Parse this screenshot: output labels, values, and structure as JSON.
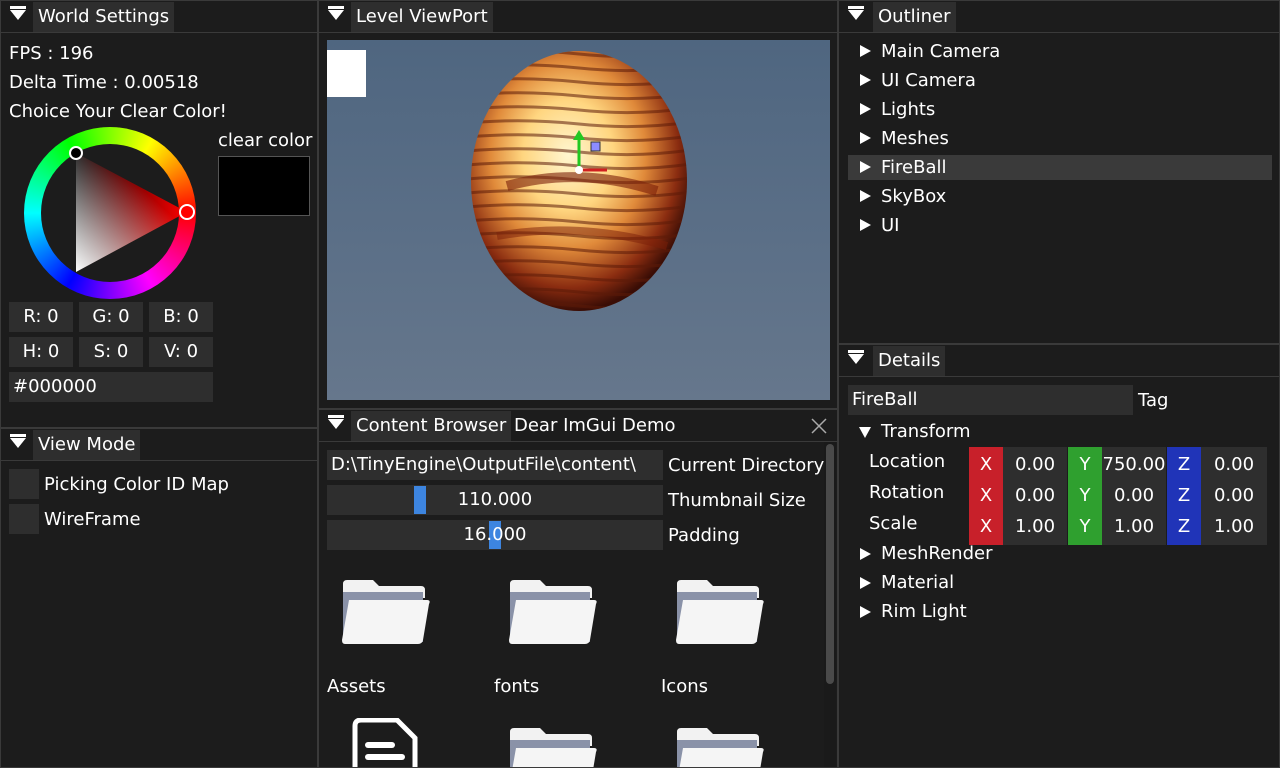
{
  "world_settings": {
    "tab": "World Settings",
    "fps": "FPS : 196",
    "delta": "Delta Time : 0.00518",
    "choice": "Choice Your Clear Color!",
    "clear_color_label": "clear color",
    "clear_color_value": "#000000",
    "r": "R:  0",
    "g": "G:  0",
    "b": "B:  0",
    "h": "H:  0",
    "s": "S:  0",
    "v": "V:  0",
    "hex": "#000000"
  },
  "view_mode": {
    "tab": "View Mode",
    "picking": "Picking Color ID Map",
    "wireframe": "WireFrame"
  },
  "viewport": {
    "tab": "Level ViewPort"
  },
  "content_browser": {
    "tab_active": "Content Browser",
    "tab_other": "Dear ImGui Demo",
    "directory_value": "D:\\TinyEngine\\OutputFile\\content\\",
    "directory_label": "Current Directory",
    "thumbnail_value": "110.000",
    "thumbnail_label": "Thumbnail Size",
    "thumbnail_fraction": 0.27,
    "padding_value": "16.000",
    "padding_label": "Padding",
    "padding_fraction": 0.5,
    "items": [
      "Assets",
      "fonts",
      "Icons"
    ]
  },
  "outliner": {
    "tab": "Outliner",
    "items": [
      "Main Camera",
      "UI Camera",
      "Lights",
      "Meshes",
      "FireBall",
      "SkyBox",
      "UI"
    ],
    "selected": "FireBall"
  },
  "details": {
    "tab": "Details",
    "name": "FireBall",
    "tag_label": "Tag",
    "transform_label": "Transform",
    "location_label": "Location",
    "rotation_label": "Rotation",
    "scale_label": "Scale",
    "axis_x": "X",
    "axis_y": "Y",
    "axis_z": "Z",
    "location": [
      "0.00",
      "750.00",
      "0.00"
    ],
    "rotation": [
      "0.00",
      "0.00",
      "0.00"
    ],
    "scale": [
      "1.00",
      "1.00",
      "1.00"
    ],
    "sections": [
      "MeshRender",
      "Material",
      "Rim Light"
    ]
  },
  "colors": {
    "panel_bg": "#1c1c1c",
    "field_bg": "#2e2e2e",
    "selected_row": "#3a3a3a",
    "slider_grab": "#3d85e0",
    "axis_x": "#c8202a",
    "axis_y": "#2fa02f",
    "axis_z": "#2034b8",
    "viewport_bg": "#5a6e85"
  }
}
